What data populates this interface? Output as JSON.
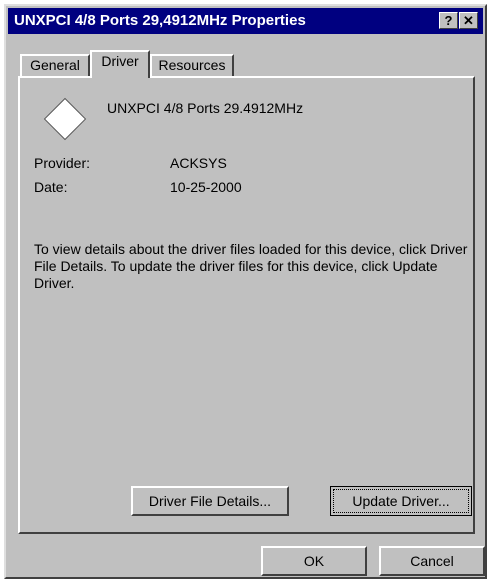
{
  "window": {
    "title": "UNXPCI 4/8 Ports 29,4912MHz Properties",
    "help_glyph": "?",
    "close_glyph": "✕"
  },
  "tabs": [
    {
      "label": "General",
      "active": false
    },
    {
      "label": "Driver",
      "active": true
    },
    {
      "label": "Resources",
      "active": false
    }
  ],
  "driver": {
    "device_icon": "device-diamond-icon",
    "device_name": "UNXPCI 4/8 Ports 29.4912MHz",
    "provider_label": "Provider:",
    "provider_value": "ACKSYS",
    "date_label": "Date:",
    "date_value": "10-25-2000",
    "description": "To view details about the driver files loaded for this device, click Driver File Details.  To update the driver files for this device, click Update Driver.",
    "details_button": "Driver File Details...",
    "update_button": "Update Driver..."
  },
  "footer": {
    "ok_button": "OK",
    "cancel_button": "Cancel"
  }
}
